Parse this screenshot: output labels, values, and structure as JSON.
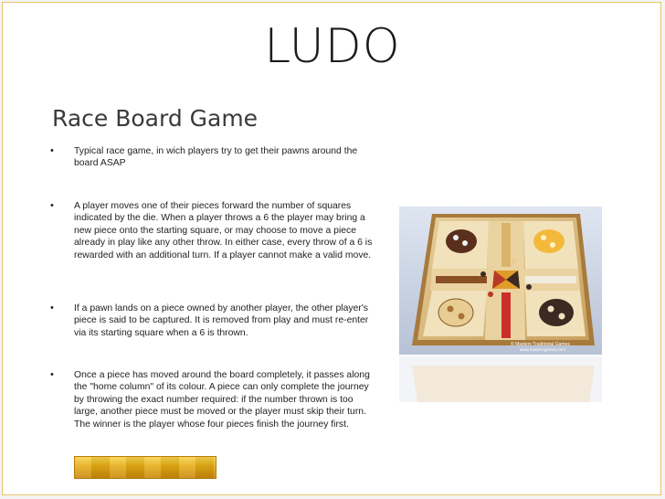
{
  "slide": {
    "title": "LUDO",
    "subtitle": "Race Board Game",
    "bullet_char": "•",
    "bullets": [
      "Typical race game, in wich players try to get their pawns around the board ASAP",
      "A player moves one of their pieces forward the number of squares indicated by the die. When a player throws a 6 the player may bring a new piece onto the starting square, or may choose to move a piece already in play like any other throw. In either case, every throw of a 6 is rewarded with an additional turn. If a player cannot make a valid move.",
      "If a pawn lands on a piece owned by another player, the other player's piece is said to be captured. It is removed from play and must re-enter via its starting square when a 6 is thrown.",
      "Once a piece has moved around the board completely, it passes along the \"home column\" of its colour. A piece can only complete the journey by throwing the exact number required: if the number thrown is too large, another piece must be moved or the player must skip their turn. The winner is the player whose four pieces finish the journey first."
    ],
    "image": {
      "name": "ludo-board-photo",
      "caption": "© Masters Traditional Games",
      "caption_url": "www.mastersgames.com"
    }
  },
  "colors": {
    "slide_border": "#e6c46a",
    "gold_bar": "#e3a912"
  }
}
